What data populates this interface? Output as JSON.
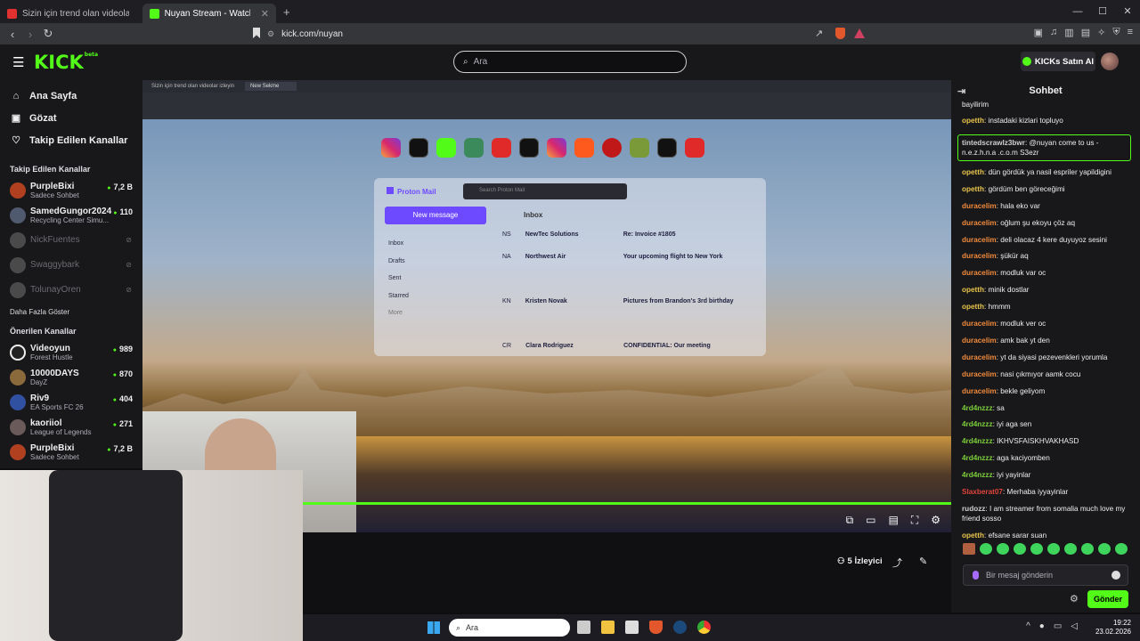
{
  "browser": {
    "tabs": [
      {
        "label": "Sizin için trend olan videolar izleyin",
        "active": false
      },
      {
        "label": "Nuyan Stream - Watch Live o",
        "active": true
      }
    ],
    "url": "kick.com/nuyan",
    "new_tab_icon": "plus-icon"
  },
  "header": {
    "logo": "KICK",
    "logo_badge": "beta",
    "search_placeholder": "Ara",
    "ai_button": "KICKs Satın AI",
    "accent": "#53fc18"
  },
  "sidebar": {
    "nav": [
      {
        "label": "Ana Sayfa",
        "icon": "home-icon"
      },
      {
        "label": "Gözat",
        "icon": "browse-icon"
      },
      {
        "label": "Takip Edilen Kanallar",
        "icon": "heart-icon"
      }
    ],
    "followed_header": "Takip Edilen Kanallar",
    "followed": [
      {
        "name": "PurpleBixi",
        "sub": "Sadece Sohbet",
        "viewers": "7,2 B",
        "color": "#b04020"
      },
      {
        "name": "SamedGungor2024",
        "sub": "Recycling Center Simu...",
        "viewers": "110",
        "color": "#505a6e"
      },
      {
        "name": "NickFuentes",
        "offline": true,
        "color": "#777"
      },
      {
        "name": "Swaggybark",
        "offline": true,
        "color": "#777"
      },
      {
        "name": "TolunayOren",
        "offline": true,
        "color": "#777"
      }
    ],
    "show_more": "Daha Fazla Göster",
    "recommended_header": "Önerilen Kanallar",
    "recommended": [
      {
        "name": "Videoyun",
        "sub": "Forest Hustle",
        "viewers": "989",
        "color": "#e0e0e0"
      },
      {
        "name": "10000DAYS",
        "sub": "DayZ",
        "viewers": "870",
        "color": "#8a6a3a"
      },
      {
        "name": "Riv9",
        "sub": "EA Sports FC 26",
        "viewers": "404",
        "color": "#3050a0"
      },
      {
        "name": "kaoriiol",
        "sub": "League of Legends",
        "viewers": "271",
        "color": "#6a5a5a"
      },
      {
        "name": "PurpleBixi",
        "sub": "Sadece Sohbet",
        "viewers": "7,2 B",
        "color": "#b04020"
      }
    ]
  },
  "video": {
    "inner_tab_1": "Sizin için trend olan videolar izleyin",
    "inner_tab_2": "New Sekme",
    "proton_brand": "Proton Mail",
    "proton_search": "Search Proton Mail",
    "new_message": "New message",
    "folders": [
      "Inbox",
      "Drafts",
      "Sent",
      "Starred",
      "More"
    ],
    "inbox_title": "Inbox",
    "mails": [
      {
        "initials": "NS",
        "from": "NewTec Solutions",
        "subject": "Re: Invoice #1805"
      },
      {
        "initials": "NA",
        "from": "Northwest Air",
        "subject": "Your upcoming flight to New York"
      },
      {
        "initials": "KN",
        "from": "Kristen Novak",
        "subject": "Pictures from Brandon's 3rd birthday"
      },
      {
        "initials": "CR",
        "from": "Clara Rodriguez",
        "subject": "CONFIDENTIAL: Our meeting"
      }
    ],
    "viewers": "5 İzleyici"
  },
  "taskbar": {
    "search": "Ara",
    "time": "19:22",
    "date": "23.02.2026"
  },
  "chat": {
    "title": "Sohbet",
    "messages": [
      {
        "user": "",
        "text": "bayilirim",
        "color": "#53fc18"
      },
      {
        "user": "opetth",
        "text": "instadaki kizlari topluyo",
        "color": "#e8c44a"
      },
      {
        "user": "tintedscrawlz3bwr",
        "text": "@nuyan come to us - n.e.z.h.n.a .c.o.m S3ezr",
        "color": "#cfcfd3",
        "highlight": true
      },
      {
        "user": "opetth",
        "text": "dün gördük ya nasil espriler yapildigini",
        "color": "#e8c44a"
      },
      {
        "user": "opetth",
        "text": "gördüm ben göreceğimi",
        "color": "#e8c44a"
      },
      {
        "user": "duracelim",
        "text": "hala eko var",
        "color": "#f08a3c"
      },
      {
        "user": "duracelim",
        "text": "oğlum şu ekoyu çöz aq",
        "color": "#f08a3c"
      },
      {
        "user": "duracelim",
        "text": "deli olacaz 4 kere duyuyoz sesini",
        "color": "#f08a3c"
      },
      {
        "user": "duracelim",
        "text": "şükür aq",
        "color": "#f08a3c"
      },
      {
        "user": "duracelim",
        "text": "modluk var oc",
        "color": "#f08a3c"
      },
      {
        "user": "opetth",
        "text": "minik dostlar",
        "color": "#e8c44a"
      },
      {
        "user": "opetth",
        "text": "hmmm",
        "color": "#e8c44a"
      },
      {
        "user": "duracelim",
        "text": "modluk ver oc",
        "color": "#f08a3c"
      },
      {
        "user": "duracelim",
        "text": "amk bak yt den",
        "color": "#f08a3c"
      },
      {
        "user": "duracelim",
        "text": "yt da siyasi pezevenkleri yorumla",
        "color": "#f08a3c"
      },
      {
        "user": "duracelim",
        "text": "nasi çıkmıyor aamk cocu",
        "color": "#f08a3c"
      },
      {
        "user": "duracelim",
        "text": "bekle geliyom",
        "color": "#f08a3c"
      },
      {
        "user": "4rd4nzzz",
        "text": "sa",
        "color": "#7ccf3a"
      },
      {
        "user": "4rd4nzzz",
        "text": "iyi aga sen",
        "color": "#7ccf3a"
      },
      {
        "user": "4rd4nzzz",
        "text": "IKHVSFAISKHVAKHASD",
        "color": "#7ccf3a"
      },
      {
        "user": "4rd4nzzz",
        "text": "aga kaciyomben",
        "color": "#7ccf3a"
      },
      {
        "user": "4rd4nzzz",
        "text": "iyi yayinlar",
        "color": "#7ccf3a"
      },
      {
        "user": "Slaxberat07",
        "text": "Merhaba iyyayinlar",
        "color": "#e0443a"
      },
      {
        "user": "rudozz",
        "text": "I am streamer from somalia much love my friend sosso",
        "color": "#cfcfd3"
      },
      {
        "user": "opetth",
        "text": "efsane sarar suan",
        "color": "#e8c44a"
      }
    ],
    "input_placeholder": "Bir mesaj gönderin",
    "send_label": "Gönder"
  }
}
